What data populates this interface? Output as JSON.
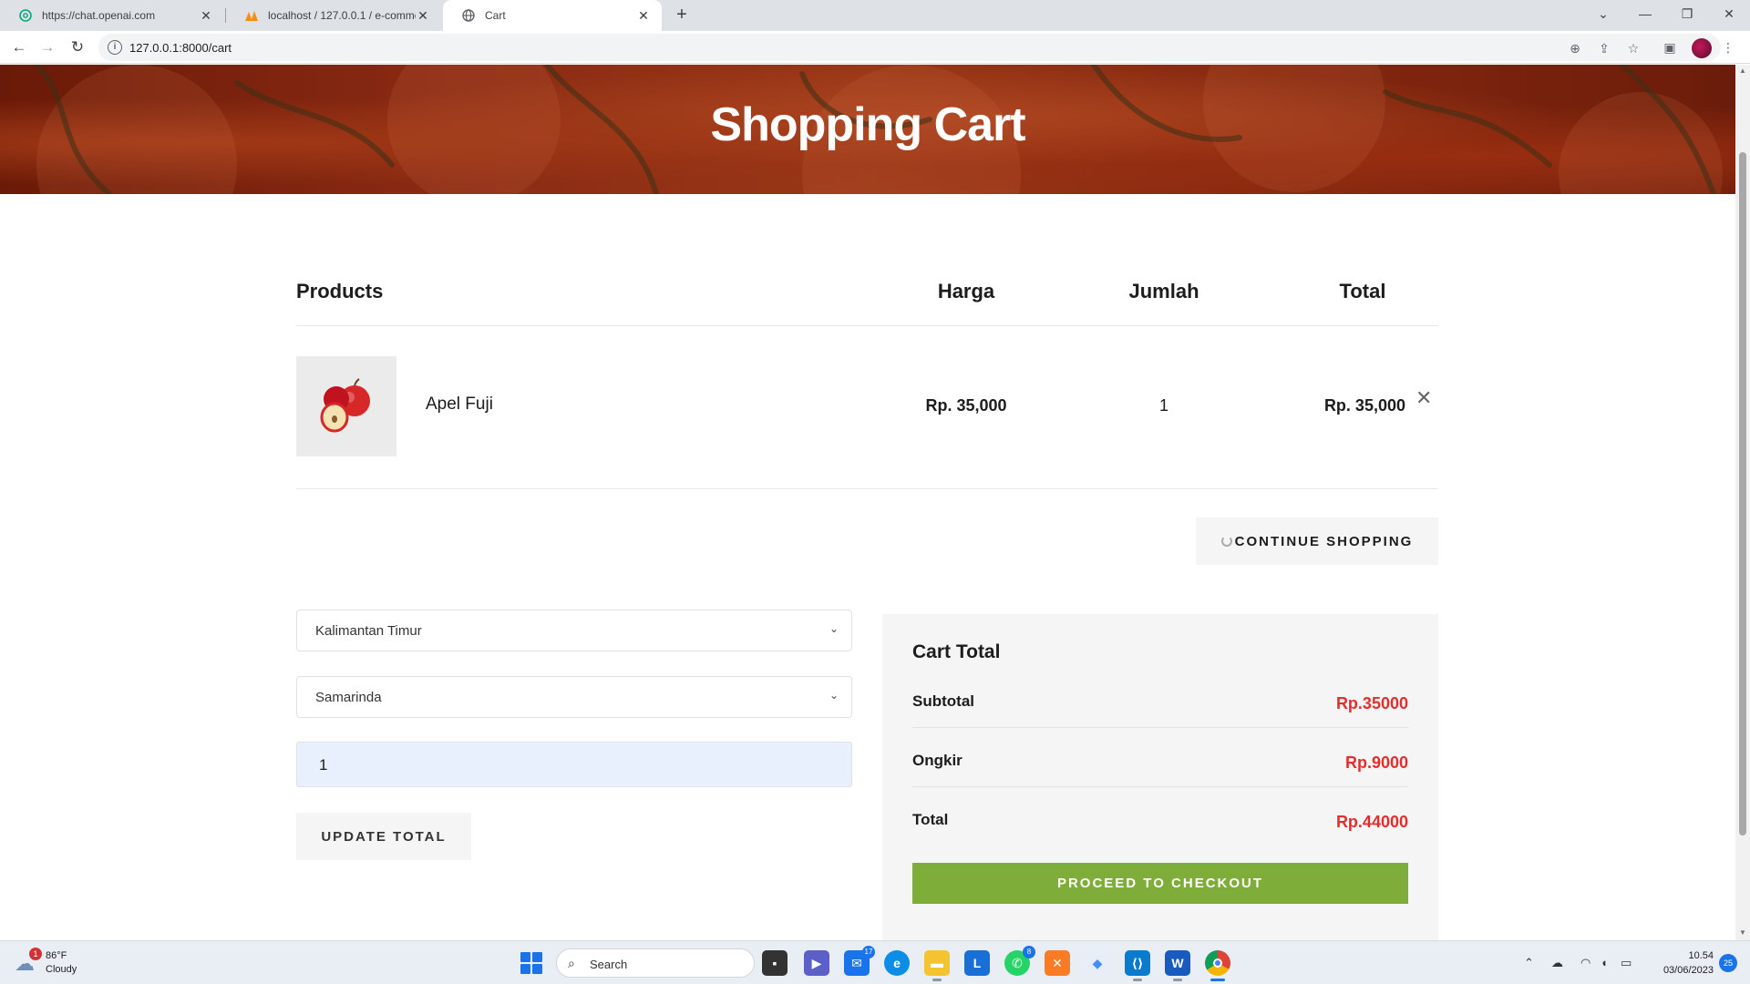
{
  "browser": {
    "tabs": [
      {
        "label": "https://chat.openai.com",
        "icon": "openai-icon"
      },
      {
        "label": "localhost / 127.0.0.1 / e-commerce",
        "icon": "phpmyadmin-icon"
      },
      {
        "label": "Cart",
        "icon": "globe-icon",
        "active": true
      }
    ],
    "url": "127.0.0.1:8000/cart"
  },
  "page": {
    "hero_title": "Shopping Cart",
    "table": {
      "headers": {
        "products": "Products",
        "price": "Harga",
        "qty": "Jumlah",
        "total": "Total"
      },
      "rows": [
        {
          "name": "Apel Fuji",
          "price": "Rp. 35,000",
          "qty": "1",
          "total": "Rp. 35,000"
        }
      ]
    },
    "continue_label": "CONTINUE SHOPPING",
    "province_select": "Kalimantan Timur",
    "city_select": "Samarinda",
    "qty_input_value": "1",
    "update_label": "UPDATE TOTAL",
    "cart_total": {
      "title": "Cart Total",
      "subtotal_label": "Subtotal",
      "subtotal_value": "Rp.35000",
      "shipping_label": "Ongkir",
      "shipping_value": "Rp.9000",
      "total_label": "Total",
      "total_value": "Rp.44000",
      "checkout_label": "PROCEED TO CHECKOUT"
    },
    "colors": {
      "accent_green": "#7fad39",
      "price_red": "#e52d2d"
    }
  },
  "taskbar": {
    "weather_temp": "86°F",
    "weather_cond": "Cloudy",
    "weather_badge": "1",
    "search_label": "Search",
    "mail_badge": "17",
    "whatsapp_badge": "8",
    "time": "10.54",
    "date": "03/06/2023",
    "notification_count": "25"
  }
}
